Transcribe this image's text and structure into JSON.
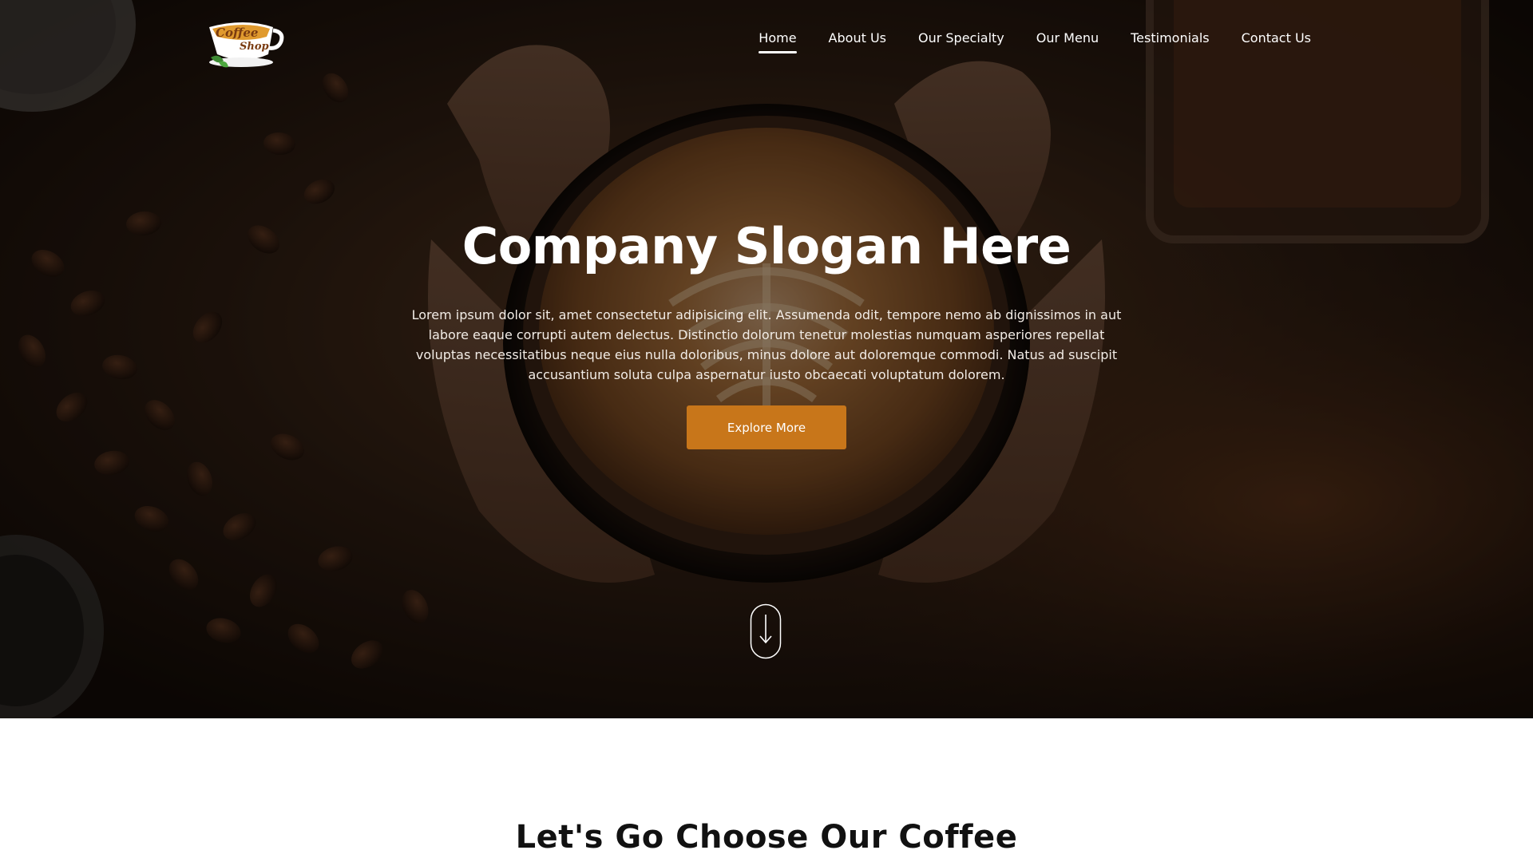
{
  "logo": {
    "text_line1": "Coffee",
    "text_line2": "Shop"
  },
  "nav": {
    "items": [
      {
        "label": "Home"
      },
      {
        "label": "About Us"
      },
      {
        "label": "Our Specialty"
      },
      {
        "label": "Our Menu"
      },
      {
        "label": "Testimonials"
      },
      {
        "label": "Contact Us"
      }
    ],
    "active": "Home"
  },
  "hero": {
    "title": "Company Slogan Here",
    "text": "Lorem ipsum dolor sit, amet consectetur adipisicing elit. Assumenda odit, tempore nemo ab dignissimos in aut labore eaque corrupti autem delectus. Distinctio dolorum tenetur molestias numquam asperiores repellat voluptas necessitatibus neque eius nulla doloribus, minus dolore aut doloremque commodi. Natus ad suscipit accusantium soluta culpa aspernatur iusto obcaecati voluptatum dolorem.",
    "button_label": "Explore More",
    "scroll_icon": "arrow-down-icon"
  },
  "section": {
    "title": "Let's Go Choose Our Coffee"
  },
  "colors": {
    "accent": "#c8761a",
    "hero_dark": "#1c120b",
    "text_dark": "#111111",
    "white": "#ffffff"
  }
}
